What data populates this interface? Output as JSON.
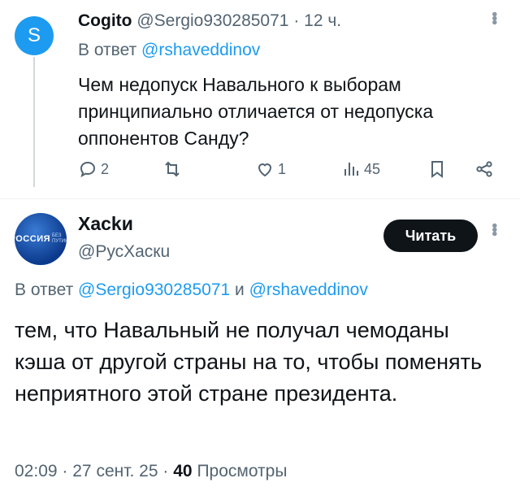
{
  "reply_tweet": {
    "avatar_letter": "S",
    "display_name": "Cogito",
    "handle": "@Sergio930285071",
    "separator": "·",
    "time": "12 ч.",
    "replying_prefix": "В ответ",
    "replying_to": "@rshaveddinov",
    "text": "Чем недопуск Навального к выборам принципиально отличается от недопуска оппонентов Санду?",
    "replies": "2",
    "retweets": "",
    "likes": "1",
    "views": "45",
    "more_icon": "more-vertical-icon"
  },
  "main_tweet": {
    "avatar_logo": "РОССИЯ",
    "avatar_logo_sub": "БЕЗ ПУТИНА",
    "display_name": "Хасkи",
    "handle": "@РусХаскu",
    "follow_label": "Читать",
    "replying_prefix": "В ответ",
    "replying_to_1": "@Sergio930285071",
    "replying_joiner": "и",
    "replying_to_2": "@rshaveddinov",
    "text": "тем, что Навальный не получал чемоданы кэша от другой страны на то, чтобы поменять неприятного этой стране президента.",
    "time": "02:09",
    "date": "27 сент. 25",
    "views_count": "40",
    "views_label": "Просмотры"
  },
  "colors": {
    "accent": "#1d9bf0",
    "text": "#0f1419",
    "muted": "#536471"
  }
}
